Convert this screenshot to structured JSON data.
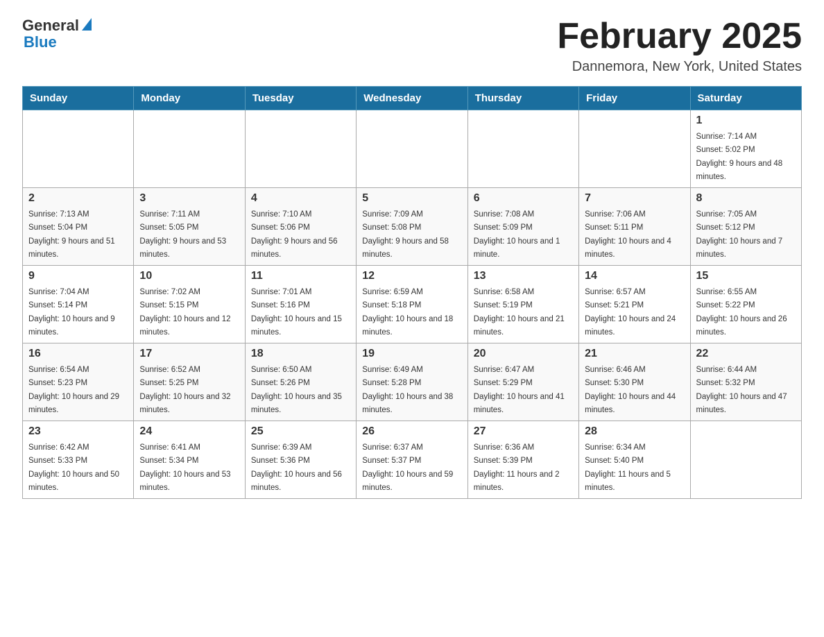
{
  "logo": {
    "general": "General",
    "blue": "Blue"
  },
  "header": {
    "title": "February 2025",
    "subtitle": "Dannemora, New York, United States"
  },
  "weekdays": [
    "Sunday",
    "Monday",
    "Tuesday",
    "Wednesday",
    "Thursday",
    "Friday",
    "Saturday"
  ],
  "weeks": [
    [
      {
        "day": "",
        "sunrise": "",
        "sunset": "",
        "daylight": ""
      },
      {
        "day": "",
        "sunrise": "",
        "sunset": "",
        "daylight": ""
      },
      {
        "day": "",
        "sunrise": "",
        "sunset": "",
        "daylight": ""
      },
      {
        "day": "",
        "sunrise": "",
        "sunset": "",
        "daylight": ""
      },
      {
        "day": "",
        "sunrise": "",
        "sunset": "",
        "daylight": ""
      },
      {
        "day": "",
        "sunrise": "",
        "sunset": "",
        "daylight": ""
      },
      {
        "day": "1",
        "sunrise": "Sunrise: 7:14 AM",
        "sunset": "Sunset: 5:02 PM",
        "daylight": "Daylight: 9 hours and 48 minutes."
      }
    ],
    [
      {
        "day": "2",
        "sunrise": "Sunrise: 7:13 AM",
        "sunset": "Sunset: 5:04 PM",
        "daylight": "Daylight: 9 hours and 51 minutes."
      },
      {
        "day": "3",
        "sunrise": "Sunrise: 7:11 AM",
        "sunset": "Sunset: 5:05 PM",
        "daylight": "Daylight: 9 hours and 53 minutes."
      },
      {
        "day": "4",
        "sunrise": "Sunrise: 7:10 AM",
        "sunset": "Sunset: 5:06 PM",
        "daylight": "Daylight: 9 hours and 56 minutes."
      },
      {
        "day": "5",
        "sunrise": "Sunrise: 7:09 AM",
        "sunset": "Sunset: 5:08 PM",
        "daylight": "Daylight: 9 hours and 58 minutes."
      },
      {
        "day": "6",
        "sunrise": "Sunrise: 7:08 AM",
        "sunset": "Sunset: 5:09 PM",
        "daylight": "Daylight: 10 hours and 1 minute."
      },
      {
        "day": "7",
        "sunrise": "Sunrise: 7:06 AM",
        "sunset": "Sunset: 5:11 PM",
        "daylight": "Daylight: 10 hours and 4 minutes."
      },
      {
        "day": "8",
        "sunrise": "Sunrise: 7:05 AM",
        "sunset": "Sunset: 5:12 PM",
        "daylight": "Daylight: 10 hours and 7 minutes."
      }
    ],
    [
      {
        "day": "9",
        "sunrise": "Sunrise: 7:04 AM",
        "sunset": "Sunset: 5:14 PM",
        "daylight": "Daylight: 10 hours and 9 minutes."
      },
      {
        "day": "10",
        "sunrise": "Sunrise: 7:02 AM",
        "sunset": "Sunset: 5:15 PM",
        "daylight": "Daylight: 10 hours and 12 minutes."
      },
      {
        "day": "11",
        "sunrise": "Sunrise: 7:01 AM",
        "sunset": "Sunset: 5:16 PM",
        "daylight": "Daylight: 10 hours and 15 minutes."
      },
      {
        "day": "12",
        "sunrise": "Sunrise: 6:59 AM",
        "sunset": "Sunset: 5:18 PM",
        "daylight": "Daylight: 10 hours and 18 minutes."
      },
      {
        "day": "13",
        "sunrise": "Sunrise: 6:58 AM",
        "sunset": "Sunset: 5:19 PM",
        "daylight": "Daylight: 10 hours and 21 minutes."
      },
      {
        "day": "14",
        "sunrise": "Sunrise: 6:57 AM",
        "sunset": "Sunset: 5:21 PM",
        "daylight": "Daylight: 10 hours and 24 minutes."
      },
      {
        "day": "15",
        "sunrise": "Sunrise: 6:55 AM",
        "sunset": "Sunset: 5:22 PM",
        "daylight": "Daylight: 10 hours and 26 minutes."
      }
    ],
    [
      {
        "day": "16",
        "sunrise": "Sunrise: 6:54 AM",
        "sunset": "Sunset: 5:23 PM",
        "daylight": "Daylight: 10 hours and 29 minutes."
      },
      {
        "day": "17",
        "sunrise": "Sunrise: 6:52 AM",
        "sunset": "Sunset: 5:25 PM",
        "daylight": "Daylight: 10 hours and 32 minutes."
      },
      {
        "day": "18",
        "sunrise": "Sunrise: 6:50 AM",
        "sunset": "Sunset: 5:26 PM",
        "daylight": "Daylight: 10 hours and 35 minutes."
      },
      {
        "day": "19",
        "sunrise": "Sunrise: 6:49 AM",
        "sunset": "Sunset: 5:28 PM",
        "daylight": "Daylight: 10 hours and 38 minutes."
      },
      {
        "day": "20",
        "sunrise": "Sunrise: 6:47 AM",
        "sunset": "Sunset: 5:29 PM",
        "daylight": "Daylight: 10 hours and 41 minutes."
      },
      {
        "day": "21",
        "sunrise": "Sunrise: 6:46 AM",
        "sunset": "Sunset: 5:30 PM",
        "daylight": "Daylight: 10 hours and 44 minutes."
      },
      {
        "day": "22",
        "sunrise": "Sunrise: 6:44 AM",
        "sunset": "Sunset: 5:32 PM",
        "daylight": "Daylight: 10 hours and 47 minutes."
      }
    ],
    [
      {
        "day": "23",
        "sunrise": "Sunrise: 6:42 AM",
        "sunset": "Sunset: 5:33 PM",
        "daylight": "Daylight: 10 hours and 50 minutes."
      },
      {
        "day": "24",
        "sunrise": "Sunrise: 6:41 AM",
        "sunset": "Sunset: 5:34 PM",
        "daylight": "Daylight: 10 hours and 53 minutes."
      },
      {
        "day": "25",
        "sunrise": "Sunrise: 6:39 AM",
        "sunset": "Sunset: 5:36 PM",
        "daylight": "Daylight: 10 hours and 56 minutes."
      },
      {
        "day": "26",
        "sunrise": "Sunrise: 6:37 AM",
        "sunset": "Sunset: 5:37 PM",
        "daylight": "Daylight: 10 hours and 59 minutes."
      },
      {
        "day": "27",
        "sunrise": "Sunrise: 6:36 AM",
        "sunset": "Sunset: 5:39 PM",
        "daylight": "Daylight: 11 hours and 2 minutes."
      },
      {
        "day": "28",
        "sunrise": "Sunrise: 6:34 AM",
        "sunset": "Sunset: 5:40 PM",
        "daylight": "Daylight: 11 hours and 5 minutes."
      },
      {
        "day": "",
        "sunrise": "",
        "sunset": "",
        "daylight": ""
      }
    ]
  ]
}
